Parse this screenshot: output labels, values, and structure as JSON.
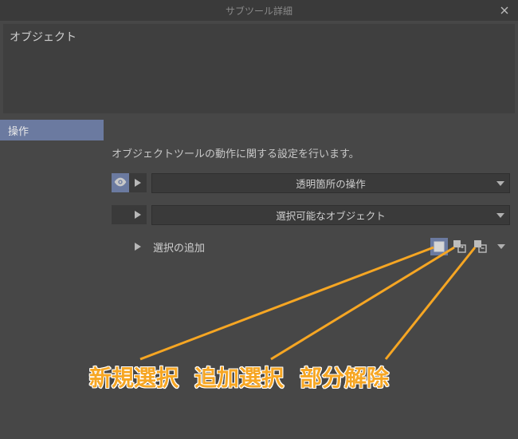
{
  "window": {
    "title": "サブツール詳細"
  },
  "name_area": {
    "value": "オブジェクト"
  },
  "tab": {
    "label": "操作"
  },
  "description": "オブジェクトツールの動作に関する設定を行います。",
  "options": {
    "row1": {
      "label": "透明箇所の操作"
    },
    "row2": {
      "label": "選択可能なオブジェクト"
    },
    "row3": {
      "label": "選択の追加"
    }
  },
  "annotations": {
    "a1": "新規選択",
    "a2": "追加選択",
    "a3": "部分解除"
  }
}
